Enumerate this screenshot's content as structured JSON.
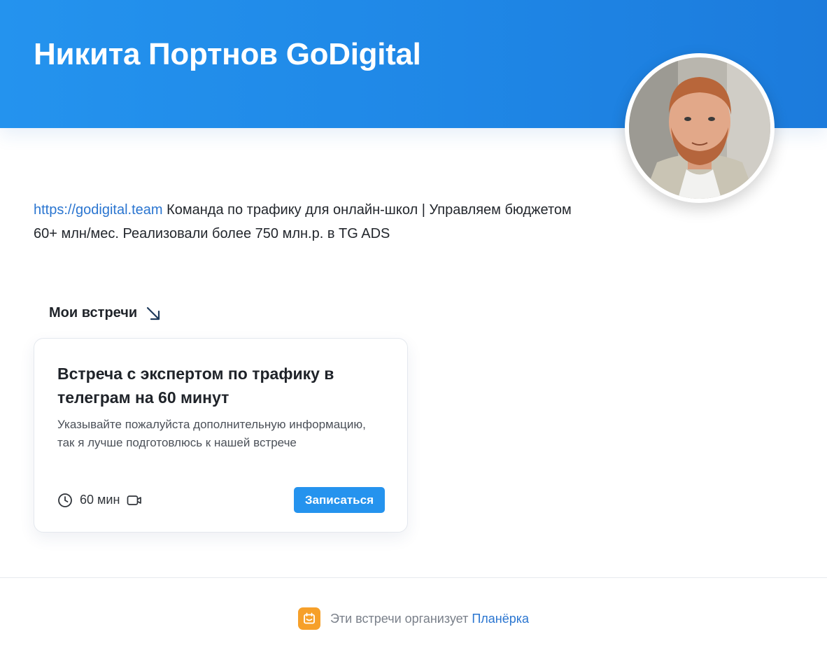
{
  "header": {
    "title": "Никита Портнов GoDigital"
  },
  "bio": {
    "link_text": "https://godigital.team",
    "text": " Команда по трафику для онлайн-школ | Управляем бюджетом 60+ млн/мес. Реализовали более 750 млн.р. в TG ADS"
  },
  "meetings": {
    "heading": "Мои встречи",
    "items": [
      {
        "title": "Встреча с экспертом по трафику в телеграм на 60 минут",
        "description": "Указывайте пожалуйста дополнительную информацию, так я лучше подготовлюсь к нашей встрече",
        "duration": "60 мин",
        "button_label": "Записаться"
      }
    ]
  },
  "footer": {
    "text": "Эти встречи организует",
    "brand_link": "Планёрка"
  },
  "colors": {
    "header_blue": "#1f87e6",
    "link_blue": "#2a75d0",
    "button_blue": "#2593ee",
    "brand_orange": "#f6a02a"
  }
}
